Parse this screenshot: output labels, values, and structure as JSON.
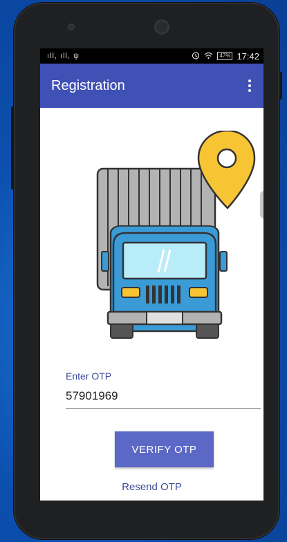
{
  "status_bar": {
    "signal_text": "ıll, ıll, ψ",
    "battery": "47%",
    "time": "17:42",
    "icons": [
      "alarm-icon",
      "wifi-icon",
      "battery-icon"
    ]
  },
  "app_bar": {
    "title": "Registration",
    "overflow_icon": "more-vert-icon"
  },
  "form": {
    "otp_label": "Enter OTP",
    "otp_value": "57901969",
    "verify_button": "VERIFY OTP",
    "resend_link": "Resend OTP"
  },
  "colors": {
    "primary": "#3f51b5",
    "button": "#5b68c6",
    "accent_text": "#3b4a99",
    "pin": "#f7c534",
    "truck_blue": "#3a9bd6"
  }
}
